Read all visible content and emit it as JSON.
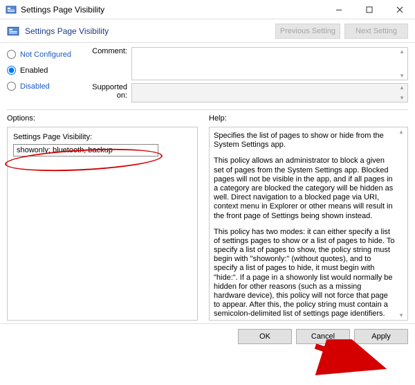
{
  "window": {
    "title": "Settings Page Visibility",
    "subtitle": "Settings Page Visibility",
    "nav_prev": "Previous Setting",
    "nav_next": "Next Setting"
  },
  "radios": {
    "not_configured": "Not Configured",
    "enabled": "Enabled",
    "disabled": "Disabled",
    "selected": "enabled"
  },
  "labels": {
    "comment": "Comment:",
    "supported_on": "Supported on:",
    "options": "Options:",
    "help": "Help:"
  },
  "options": {
    "field_label": "Settings Page Visibility:",
    "field_value": "showonly: bluetooth, backup"
  },
  "help": {
    "p1": "Specifies the list of pages to show or hide from the System Settings app.",
    "p2": "This policy allows an administrator to block a given set of pages from the System Settings app. Blocked pages will not be visible in the app, and if all pages in a category are blocked the category will be hidden as well. Direct navigation to a blocked page via URI, context menu in Explorer or other means will result in the front page of Settings being shown instead.",
    "p3": "This policy has two modes: it can either specify a list of settings pages to show or a list of pages to hide. To specify a list of pages to show, the policy string must begin with \"showonly:\" (without quotes), and to specify a list of pages to hide, it must begin with \"hide:\". If a page in a showonly list would normally be hidden for other reasons (such as a missing hardware device), this policy will not force that page to appear. After this, the policy string must contain a semicolon-delimited list of settings page identifiers. The identifier for any given settings page is the published URI for that page, minus the \"ms-settings:\" protocol part."
  },
  "footer": {
    "ok": "OK",
    "cancel": "Cancel",
    "apply": "Apply"
  }
}
